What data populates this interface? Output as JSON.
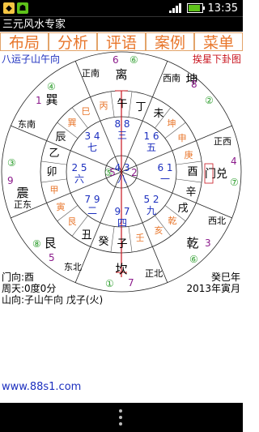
{
  "status": {
    "time": "13:35"
  },
  "app": {
    "title": "三元风水专家"
  },
  "menu": [
    "布局",
    "分析",
    "评语",
    "案例",
    "菜单"
  ],
  "subheader": {
    "left": "八运子山午向",
    "right": "挨星下卦图"
  },
  "outer_dirs": {
    "top": "离",
    "top_left": "正南",
    "top_right": "西南",
    "left": "震",
    "left_top": "东南",
    "left_bot": "正东",
    "right": "门兑",
    "right_top": "正西",
    "right_bot": "西北",
    "bottom": "坎",
    "bottom_left": "东北",
    "bottom_right": "正北",
    "tl": "巽",
    "tr": "坤",
    "bl": "艮",
    "br": "乾"
  },
  "outer_nums": {
    "top_n": "6",
    "tl_n": "1",
    "tr_n": "8",
    "left_n": "9",
    "right_n": "4",
    "bl_n": "5",
    "br_n": "3",
    "bottom_n": "7"
  },
  "circled": {
    "top_c": "⑥",
    "tl_c": "④",
    "tr_c": "②",
    "left_c": "③",
    "right_c": "⑦",
    "bl_c": "⑧",
    "br_c": "⑥",
    "bottom_c": "①",
    "center_c": "⑤"
  },
  "mountains": {
    "wu": "午",
    "ding": "丁",
    "wei": "未",
    "shen2": "申",
    "you": "酉",
    "xin": "辛",
    "xu": "戌",
    "hai": "亥",
    "zi": "子",
    "gui": "癸",
    "chou": "丑",
    "yin2": "寅",
    "mao": "卯",
    "yi": "乙",
    "chen": "辰",
    "bing": "丙",
    "si": "巳",
    "xun": "巽",
    "kun": "坤",
    "geng": "庚",
    "gan": "乾",
    "ren": "壬",
    "gen": "艮",
    "jia": "甲",
    "qian_shen": "申"
  },
  "stars": {
    "s_top": "8 8",
    "s_top_n": "三",
    "s_tl": "3 4",
    "s_tl_n": "七",
    "s_tr": "1 6",
    "s_tr_n": "五",
    "s_l": "2 5",
    "s_l_n": "六",
    "s_c": "4 3",
    "s_c_n": "八",
    "s_c_l": "5",
    "s_c_r": "2",
    "s_r": "6 1",
    "s_r_n": "一",
    "s_bl": "7 9",
    "s_bl_n": "二",
    "s_b": "9 7",
    "s_b_n": "四",
    "s_br": "5 2",
    "s_br_n": "九"
  },
  "info": {
    "door": "门向:酉",
    "period": "周天:0度0分",
    "facing": "山向:子山午向 戊子(火)",
    "year_a": "癸巳年",
    "year_b": "2013年寅月"
  },
  "site": "www.88s1.com",
  "colors": {
    "accent": "#e8762b",
    "blue": "#1c2fbf",
    "red": "#c8141e",
    "green": "#2e9e2e",
    "purple": "#8b1a8b"
  }
}
